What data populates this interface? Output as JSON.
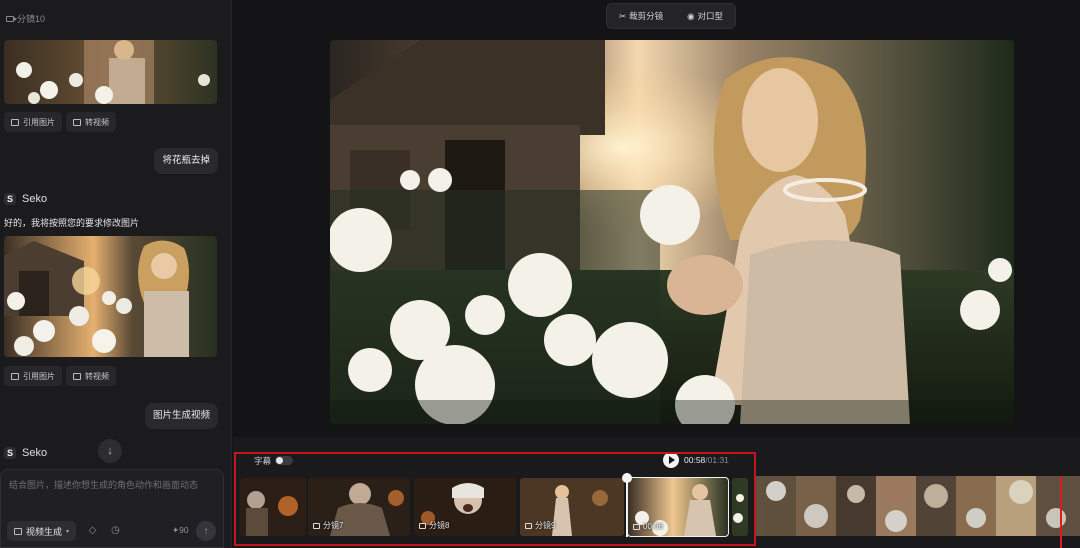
{
  "chat": {
    "header_label": "分镜10",
    "actions_1": {
      "quote_label": "引用图片",
      "to_video_label": "转视频"
    },
    "user_msg_1": "将花瓶去掉",
    "bot_name_1": "Seko",
    "bot_reply_1": "好的，我将按照您的要求修改图片",
    "actions_2": {
      "quote_label": "引用图片",
      "to_video_label": "转视频"
    },
    "user_msg_2": "图片生成视频",
    "bot_name_2": "Seko"
  },
  "composer": {
    "placeholder": "结合图片，描述你想生成的角色动作和画面动态",
    "mode_label": "视频生成",
    "credits": "90"
  },
  "toolbar": {
    "cut_label": "裁剪分镜",
    "lipsync_label": "对口型"
  },
  "timeline": {
    "subtitle_label": "字幕",
    "subtitle_on": false,
    "current_time": "00:58",
    "total_time": "/01:31",
    "clips": [
      {
        "label": ""
      },
      {
        "label": "分镜7"
      },
      {
        "label": "分镜8"
      },
      {
        "label": "分镜9"
      },
      {
        "label": "00:06"
      }
    ]
  },
  "colors": {
    "accent_red": "#c4161c",
    "panel": "#1b1b1e",
    "background": "#141416"
  }
}
